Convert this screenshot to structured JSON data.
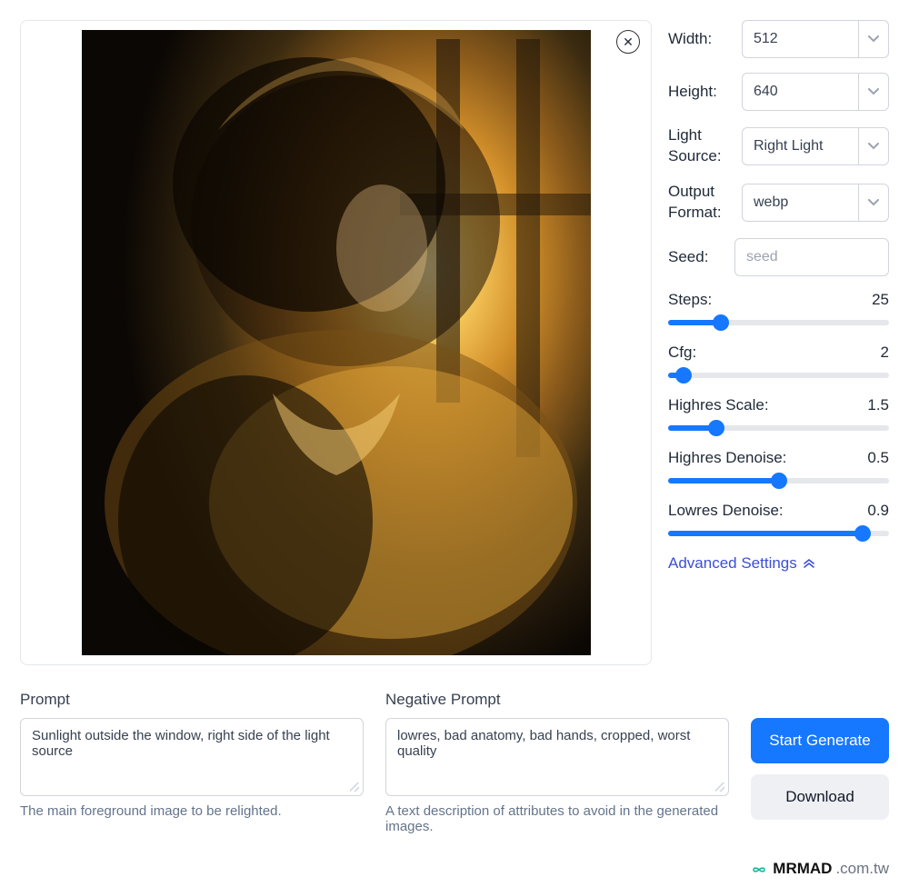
{
  "preview": {
    "close_icon": "✕"
  },
  "controls": {
    "width": {
      "label": "Width:",
      "value": "512"
    },
    "height": {
      "label": "Height:",
      "value": "640"
    },
    "light_source": {
      "label_l1": "Light",
      "label_l2": "Source:",
      "value": "Right Light"
    },
    "output_format": {
      "label_l1": "Output",
      "label_l2": "Format:",
      "value": "webp"
    },
    "seed": {
      "label": "Seed:",
      "placeholder": "seed"
    },
    "sliders": {
      "steps": {
        "label": "Steps:",
        "value": "25",
        "percent": 24
      },
      "cfg": {
        "label": "Cfg:",
        "value": "2",
        "percent": 7
      },
      "highres_scale": {
        "label": "Highres Scale:",
        "value": "1.5",
        "percent": 22
      },
      "highres_denoise": {
        "label": "Highres Denoise:",
        "value": "0.5",
        "percent": 50
      },
      "lowres_denoise": {
        "label": "Lowres Denoise:",
        "value": "0.9",
        "percent": 88
      }
    },
    "advanced_label": "Advanced Settings"
  },
  "prompt": {
    "title": "Prompt",
    "value": "Sunlight outside the window, right side of the light source",
    "hint": "The main foreground image to be relighted."
  },
  "negative": {
    "title": "Negative Prompt",
    "value": "lowres, bad anatomy, bad hands, cropped, worst quality",
    "hint": "A text description of attributes to avoid in the generated images."
  },
  "buttons": {
    "generate": "Start Generate",
    "download": "Download"
  },
  "watermark": {
    "brand": "MRMAD",
    "domain": ".com.tw"
  }
}
